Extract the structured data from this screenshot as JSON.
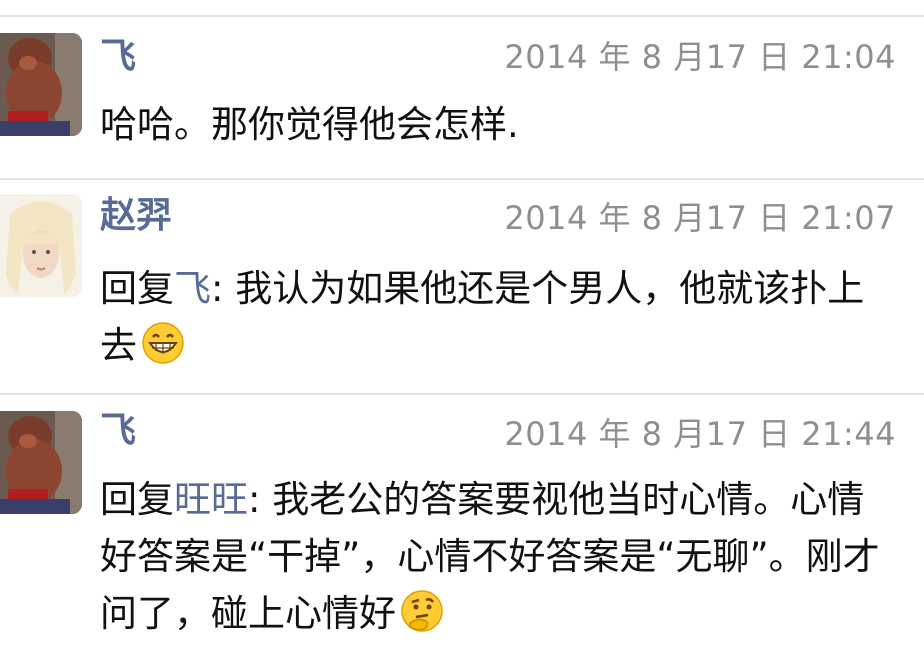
{
  "comments": [
    {
      "author": "飞",
      "time": "2014 年 8 月17 日  21:04",
      "text": "哈哈。那你觉得他会怎样."
    },
    {
      "author": "赵羿",
      "time": "2014 年 8 月17 日  21:07",
      "reply_prefix": "回复",
      "reply_to": "飞",
      "text": ": 我认为如果他还是个男人，他就该扑上去",
      "emoji": "grinning-face-emoji"
    },
    {
      "author": "飞",
      "time": "2014 年 8 月17 日  21:44",
      "reply_prefix": "回复",
      "reply_to": "旺旺",
      "text": ": 我老公的答案要视他当时心情。心情好答案是“干掉”，心情不好答案是“无聊”。刚才问了，碰上心情好",
      "emoji": "thinking-face-emoji"
    }
  ],
  "colors": {
    "name": "#576b95",
    "time": "#8e8e93",
    "text": "#111111",
    "divider": "#e3e3e6"
  }
}
